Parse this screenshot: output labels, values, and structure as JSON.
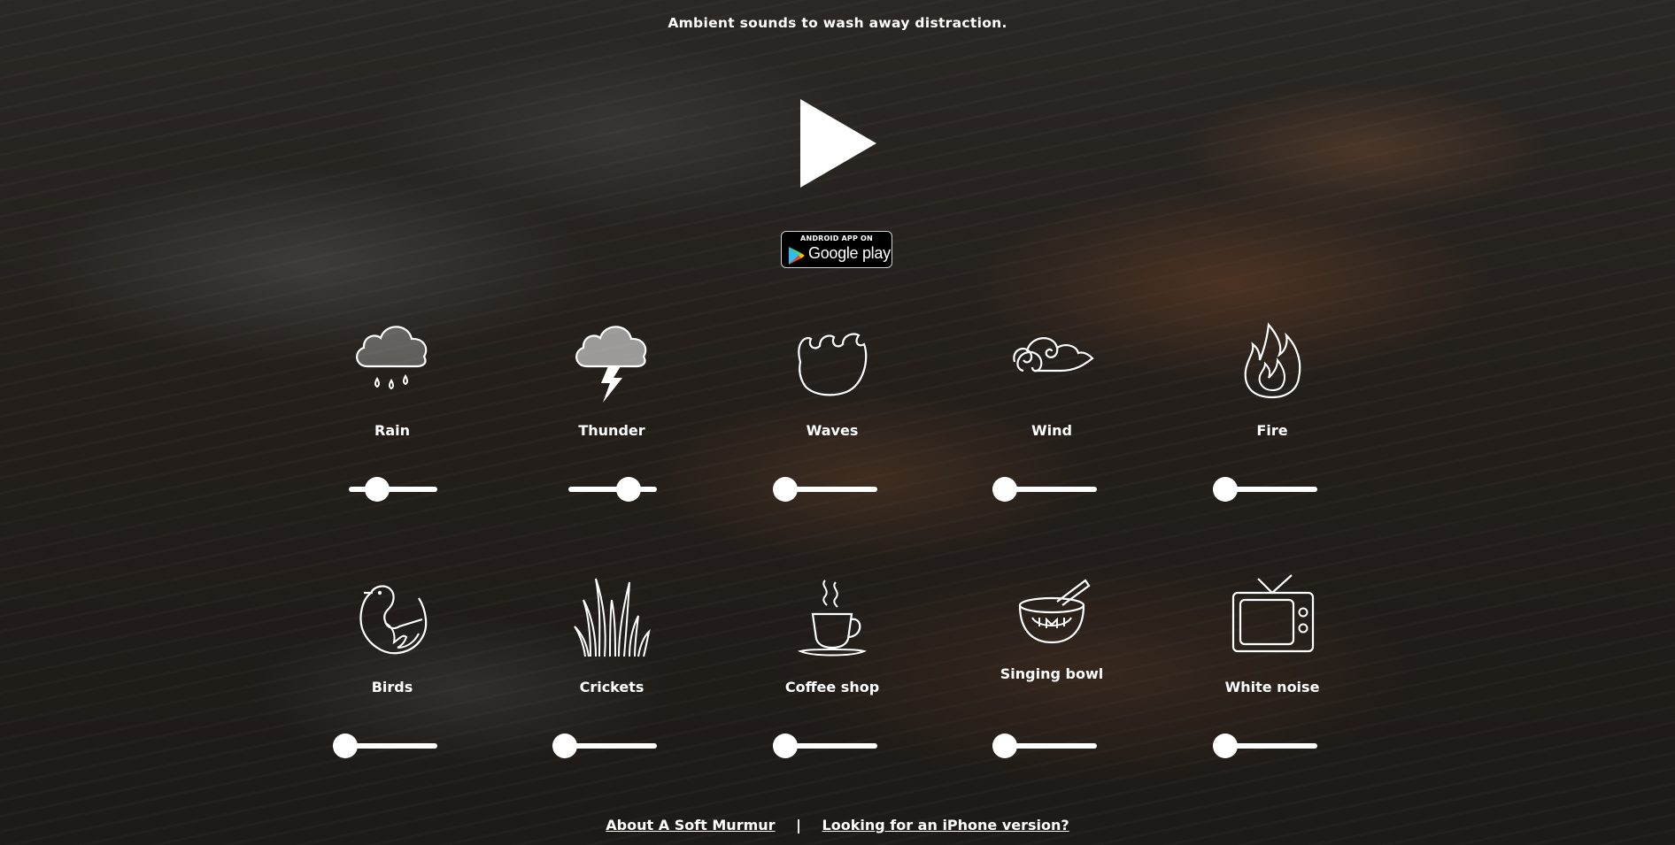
{
  "tagline": "Ambient sounds to wash away distraction.",
  "play_icon": "play-icon",
  "google_play_badge": {
    "top_text": "ANDROID APP ON",
    "main_text": "Google play",
    "icon": "google-play-icon"
  },
  "sounds": [
    {
      "id": "rain",
      "label": "Rain",
      "icon": "rain-cloud-icon",
      "volume": 0.25
    },
    {
      "id": "thunder",
      "label": "Thunder",
      "icon": "thunder-cloud-icon",
      "volume": 0.75
    },
    {
      "id": "waves",
      "label": "Waves",
      "icon": "waves-icon",
      "volume": 0
    },
    {
      "id": "wind",
      "label": "Wind",
      "icon": "wind-icon",
      "volume": 0
    },
    {
      "id": "fire",
      "label": "Fire",
      "icon": "fire-icon",
      "volume": 0
    },
    {
      "id": "birds",
      "label": "Birds",
      "icon": "bird-icon",
      "volume": 0
    },
    {
      "id": "crickets",
      "label": "Crickets",
      "icon": "grass-icon",
      "volume": 0
    },
    {
      "id": "coffee-shop",
      "label": "Coffee shop",
      "icon": "coffee-cup-icon",
      "volume": 0
    },
    {
      "id": "singing-bowl",
      "label": "Singing bowl",
      "icon": "singing-bowl-icon",
      "volume": 0
    },
    {
      "id": "white-noise",
      "label": "White noise",
      "icon": "tv-icon",
      "volume": 0
    }
  ],
  "footer": {
    "about_link": "About A Soft Murmur",
    "separator": "|",
    "iphone_link": "Looking for an iPhone version?"
  }
}
